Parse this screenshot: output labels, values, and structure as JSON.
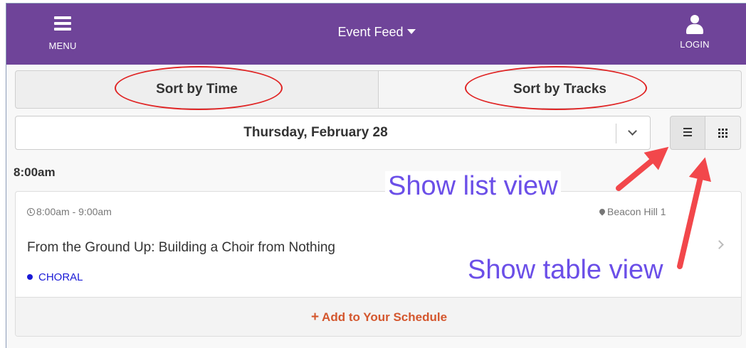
{
  "header": {
    "menu_label": "MENU",
    "title": "Event Feed",
    "login_label": "LOGIN",
    "background_color": "#6f4499"
  },
  "sort_tabs": [
    {
      "label": "Sort by Time"
    },
    {
      "label": "Sort by Tracks"
    }
  ],
  "date_selector": {
    "value": "Thursday, February 28"
  },
  "view_toggle": {
    "list_icon": "list-icon",
    "table_icon": "grid-icon"
  },
  "time_group": {
    "heading": "8:00am"
  },
  "session": {
    "time": "8:00am - 9:00am",
    "location": "Beacon Hill 1",
    "title": "From the Ground Up: Building a Choir from Nothing",
    "track": "CHORAL",
    "track_color": "#1a1ad6",
    "add_label": "Add to Your Schedule",
    "add_color": "#d4572e"
  },
  "annotations": {
    "list_view": "Show list view",
    "table_view": "Show table view",
    "color": "#6b4fe8",
    "marker_color": "#e02424"
  }
}
